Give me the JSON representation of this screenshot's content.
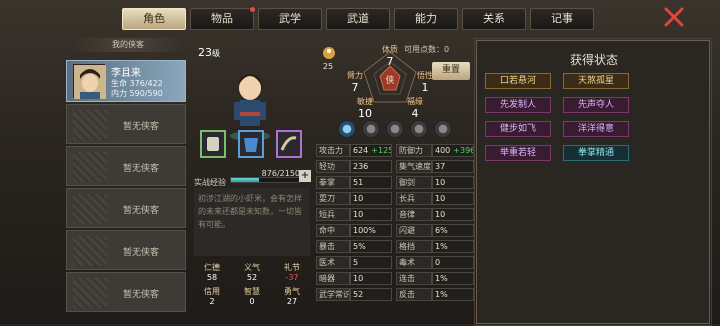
{
  "tabs": [
    {
      "label": "角色",
      "active": true
    },
    {
      "label": "物品",
      "badge": true
    },
    {
      "label": "武学"
    },
    {
      "label": "武道"
    },
    {
      "label": "能力"
    },
    {
      "label": "关系"
    },
    {
      "label": "记事"
    }
  ],
  "roster": {
    "header": "我的侠客",
    "selected": {
      "name": "李且来",
      "hp_label": "生命",
      "hp": "376/422",
      "mp_label": "内力",
      "mp": "590/590"
    },
    "empty_label": "暂无侠客"
  },
  "hero": {
    "level": "23",
    "level_unit": "级",
    "exp_label": "实战经验",
    "exp": "876/2150",
    "exp_fraction": 0.41,
    "plus": "+",
    "description": "初涉江湖的小虾米，会有怎样的未来还都是未知数，一切皆有可能。"
  },
  "virtues": [
    {
      "name": "仁德",
      "value": "58"
    },
    {
      "name": "义气",
      "value": "52"
    },
    {
      "name": "礼节",
      "value": "-37",
      "negative": true
    },
    {
      "name": "信用",
      "value": "2"
    },
    {
      "name": "智慧",
      "value": "0"
    },
    {
      "name": "勇气",
      "value": "27"
    }
  ],
  "attributes": {
    "medal_value": "25",
    "points_label": "可用点数：",
    "points": "0",
    "reset": "重置",
    "tizhi": {
      "name": "体质",
      "value": "7"
    },
    "bili": {
      "name": "臂力",
      "value": "7"
    },
    "wuxing": {
      "name": "悟性",
      "value": "1"
    },
    "minjie": {
      "name": "敏捷",
      "value": "10"
    },
    "fuyuan": {
      "name": "福缘",
      "value": "4"
    },
    "center_glyph": "侠"
  },
  "stats": [
    {
      "n1": "攻击力",
      "v1": "624",
      "b1": "+125",
      "n2": "防御力",
      "v2": "400",
      "b2": "+396"
    },
    {
      "n1": "轻功",
      "v1": "236",
      "n2": "集气速度",
      "v2": "37"
    },
    {
      "n1": "拳掌",
      "v1": "51",
      "n2": "御剑",
      "v2": "10"
    },
    {
      "n1": "耍刀",
      "v1": "10",
      "n2": "长兵",
      "v2": "10"
    },
    {
      "n1": "短兵",
      "v1": "10",
      "n2": "音律",
      "v2": "10"
    },
    {
      "n1": "命中",
      "v1": "100%",
      "n2": "闪避",
      "v2": "6%"
    },
    {
      "n1": "暴击",
      "v1": "5%",
      "n2": "格挡",
      "v2": "1%"
    },
    {
      "n1": "医术",
      "v1": "5",
      "n2": "毒术",
      "v2": "0"
    },
    {
      "n1": "暗器",
      "v1": "10",
      "n2": "连击",
      "v2": "1%"
    },
    {
      "n1": "武学常识",
      "v1": "52",
      "n2": "反击",
      "v2": "1%"
    }
  ],
  "status": {
    "title": "获得状态",
    "items": [
      {
        "label": "口若悬河",
        "style": "gold"
      },
      {
        "label": "天煞孤星",
        "style": "gold"
      },
      {
        "label": "先发制人",
        "style": "purple"
      },
      {
        "label": "先声夺人",
        "style": "purple"
      },
      {
        "label": "健步如飞",
        "style": "purple"
      },
      {
        "label": "洋洋得意",
        "style": "purple"
      },
      {
        "label": "举重若轻",
        "style": "purple"
      },
      {
        "label": "拳掌精通",
        "style": "cyan"
      }
    ]
  }
}
